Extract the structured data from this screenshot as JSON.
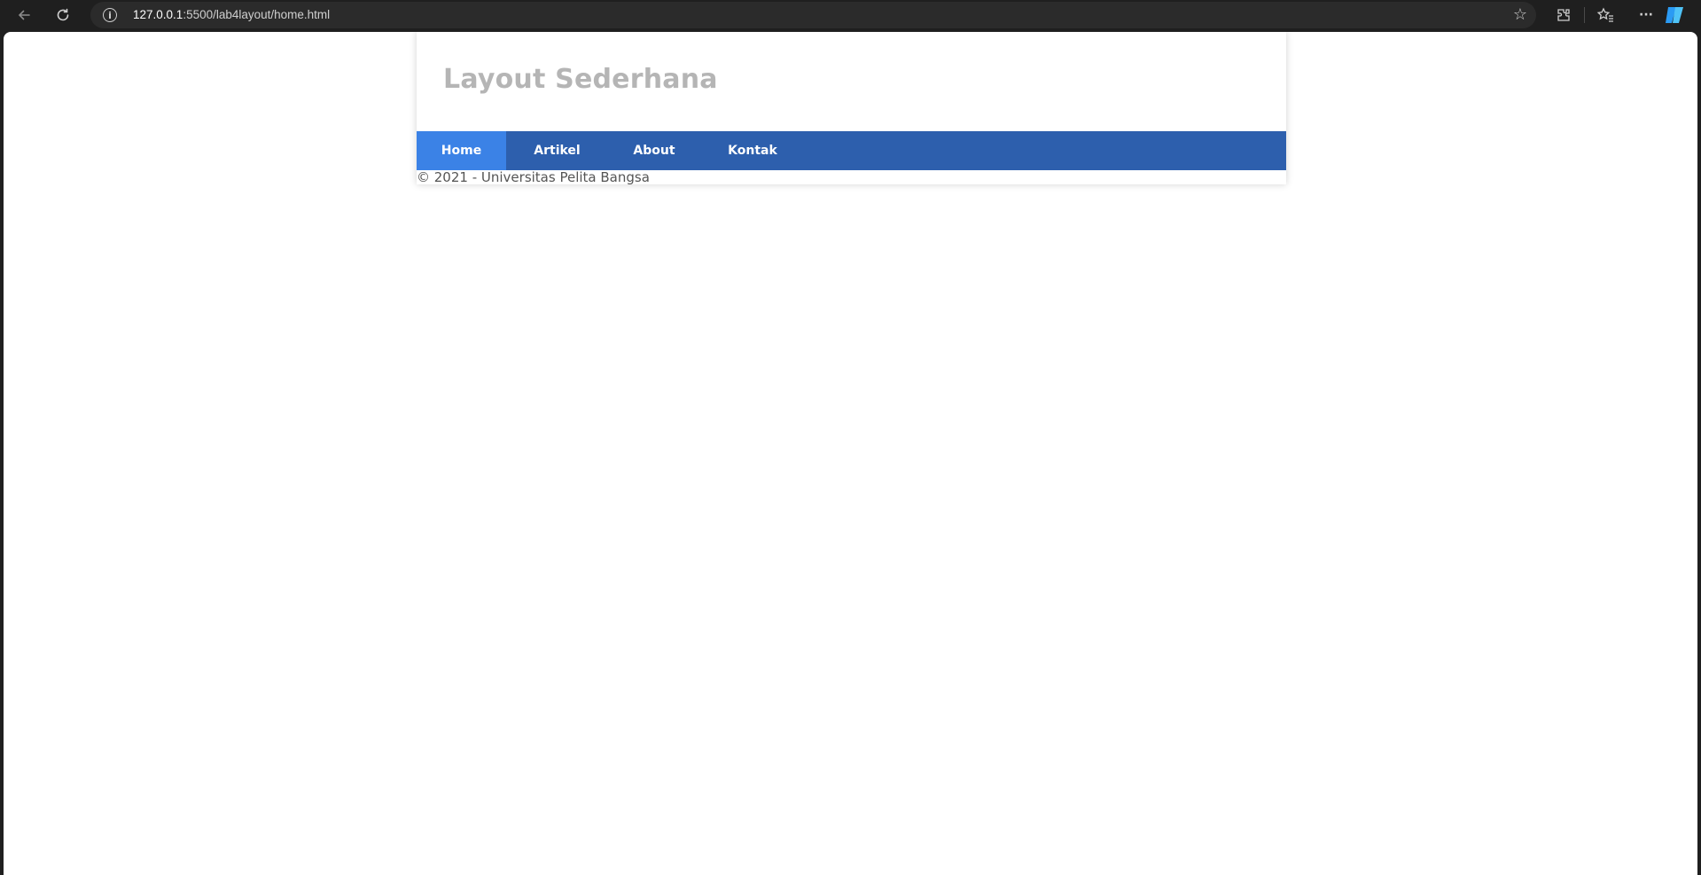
{
  "browser": {
    "url_host": "127.0.0.1",
    "url_rest": ":5500/lab4layout/home.html",
    "icons": [
      "back-icon",
      "reload-icon",
      "site-info-icon",
      "favorite-star-icon",
      "extensions-icon",
      "favorites-icon",
      "more-icon",
      "copilot-icon"
    ],
    "info_glyph": "i",
    "star_glyph": "☆",
    "ext_glyph": "⚙",
    "fav_glyph": "☆",
    "more_glyph": "···"
  },
  "page": {
    "title": "Layout Sederhana",
    "nav": [
      {
        "label": "Home",
        "active": true
      },
      {
        "label": "Artikel",
        "active": false
      },
      {
        "label": "About",
        "active": false
      },
      {
        "label": "Kontak",
        "active": false
      }
    ],
    "footer": "© 2021 - Universitas Pelita Bangsa"
  },
  "colors": {
    "nav_bg": "#2d5fad",
    "nav_active": "#3b82e6",
    "title": "#b5b5b5"
  }
}
